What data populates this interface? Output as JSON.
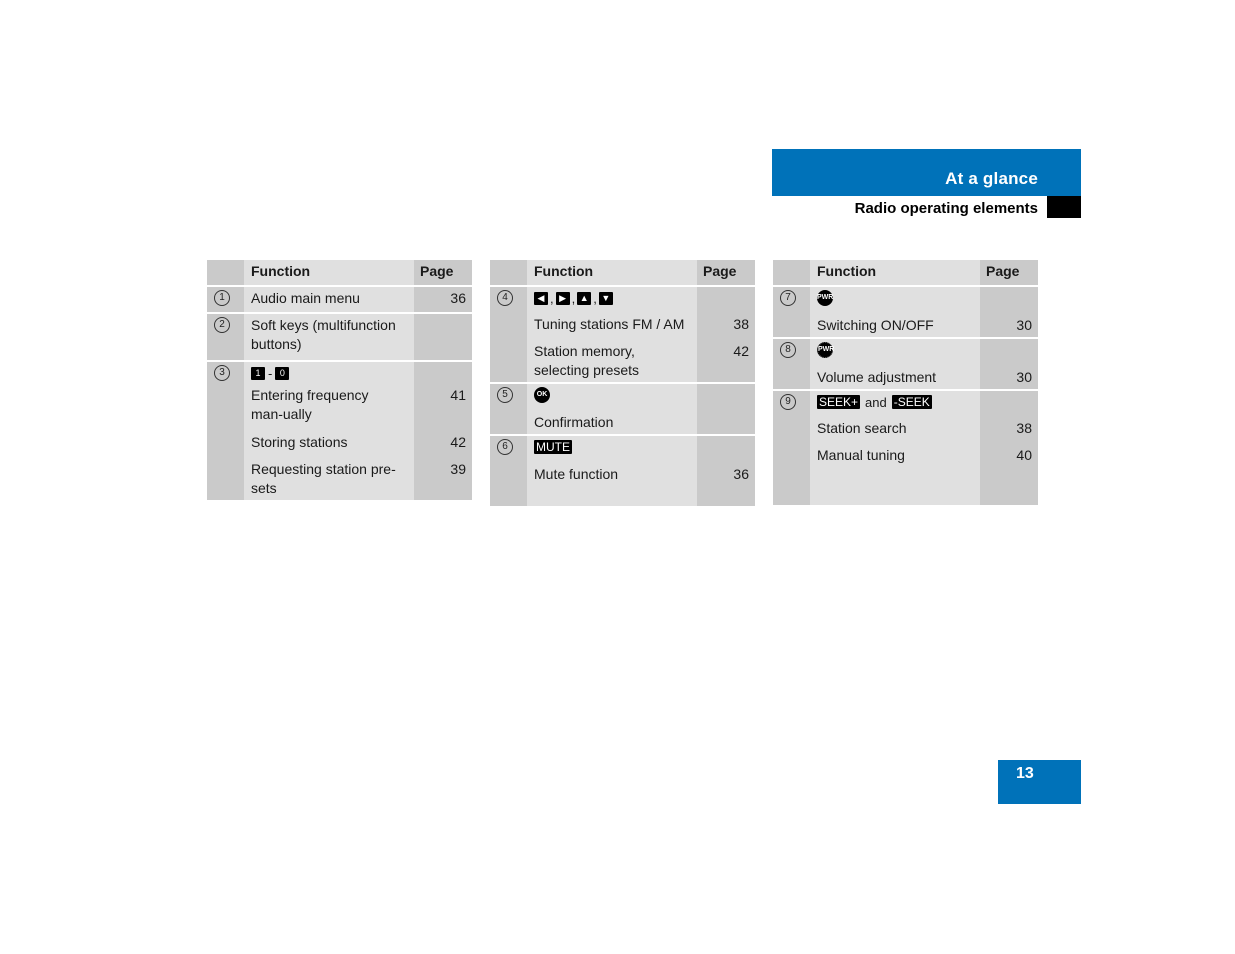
{
  "header": {
    "section_title": "At a glance",
    "subsection_title": "Radio operating elements",
    "accent_color": "#0072b9"
  },
  "table_headers": {
    "function": "Function",
    "page": "Page"
  },
  "tables": [
    {
      "rows": [
        {
          "num": "1",
          "keys": [],
          "lines": [
            {
              "text": "Audio main menu",
              "page": "36"
            }
          ]
        },
        {
          "num": "2",
          "keys": [],
          "lines": [
            {
              "text": "Soft keys (multifunction buttons)",
              "page": ""
            }
          ]
        },
        {
          "num": "3",
          "keys": [
            {
              "label": "1",
              "icon": "key-1-icon"
            },
            {
              "label": "0",
              "icon": "key-0-icon"
            }
          ],
          "key_separator": "-",
          "lines": [
            {
              "text": "Entering frequency man-ually",
              "page": "41"
            },
            {
              "text": "Storing stations",
              "page": "42"
            },
            {
              "text": "Requesting station pre-sets",
              "page": "39"
            }
          ]
        }
      ]
    },
    {
      "rows": [
        {
          "num": "4",
          "keys": [
            {
              "label": "◀",
              "icon": "left-arrow-key-icon"
            },
            {
              "label": "▶",
              "icon": "right-arrow-key-icon"
            },
            {
              "label": "▲",
              "icon": "up-arrow-key-icon"
            },
            {
              "label": "▼",
              "icon": "down-arrow-key-icon"
            }
          ],
          "key_separator": ",",
          "lines": [
            {
              "text": "Tuning stations FM / AM",
              "page": "38"
            },
            {
              "text": "Station memory, selecting presets",
              "page": "42"
            }
          ]
        },
        {
          "num": "5",
          "keys": [
            {
              "label": "OK",
              "icon": "ok-button-icon"
            }
          ],
          "lines": [
            {
              "text": "Confirmation",
              "page": ""
            }
          ]
        },
        {
          "num": "6",
          "keys": [
            {
              "label": "MUTE",
              "icon": "mute-button-icon"
            }
          ],
          "lines": [
            {
              "text": "Mute function",
              "page": "36"
            }
          ]
        }
      ]
    },
    {
      "rows": [
        {
          "num": "7",
          "keys": [
            {
              "label": "PWR",
              "icon": "power-knob-icon"
            }
          ],
          "lines": [
            {
              "text": "Switching ON/OFF",
              "page": "30"
            }
          ]
        },
        {
          "num": "8",
          "keys": [
            {
              "label": "PWR",
              "icon": "volume-knob-icon"
            }
          ],
          "lines": [
            {
              "text": "Volume adjustment",
              "page": "30"
            }
          ]
        },
        {
          "num": "9",
          "keys": [
            {
              "label": "SEEK+",
              "icon": "seek-up-button-icon"
            },
            {
              "label": "-SEEK",
              "icon": "seek-down-button-icon"
            }
          ],
          "key_separator": "and",
          "lines": [
            {
              "text": "Station search",
              "page": "38"
            },
            {
              "text": "Manual tuning",
              "page": "40"
            }
          ]
        }
      ]
    }
  ],
  "page_number": "13"
}
